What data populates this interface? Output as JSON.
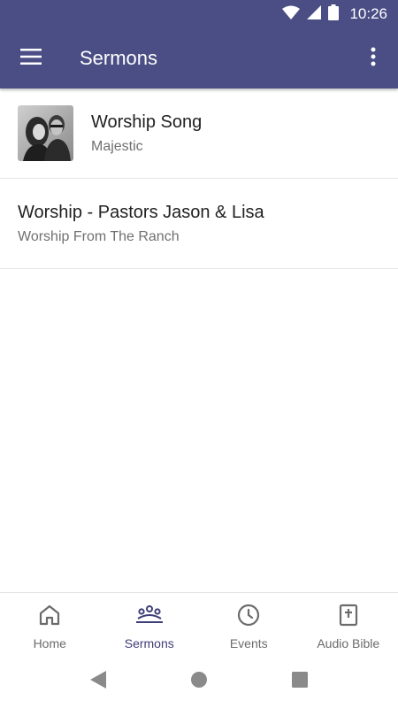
{
  "status_bar": {
    "time": "10:26",
    "icons": [
      "wifi-icon",
      "signal-icon",
      "battery-icon"
    ]
  },
  "app_bar": {
    "title": "Sermons",
    "menu_icon": "hamburger-menu-icon",
    "more_icon": "more-vert-icon"
  },
  "sermons": [
    {
      "title": "Worship Song",
      "subtitle": "Majestic",
      "has_thumbnail": true
    },
    {
      "title": "Worship - Pastors Jason & Lisa",
      "subtitle": "Worship From The Ranch",
      "has_thumbnail": false
    }
  ],
  "bottom_nav": {
    "items": [
      {
        "label": "Home",
        "icon": "home-icon",
        "active": false
      },
      {
        "label": "Sermons",
        "icon": "people-icon",
        "active": true
      },
      {
        "label": "Events",
        "icon": "clock-icon",
        "active": false
      },
      {
        "label": "Audio Bible",
        "icon": "bible-icon",
        "active": false
      }
    ]
  },
  "system_nav": {
    "icons": [
      "back-icon",
      "home-circle-icon",
      "recents-icon"
    ]
  },
  "colors": {
    "primary": "#4b4e85",
    "active_nav": "#3d3f78",
    "inactive_nav": "#6b6b6b"
  }
}
